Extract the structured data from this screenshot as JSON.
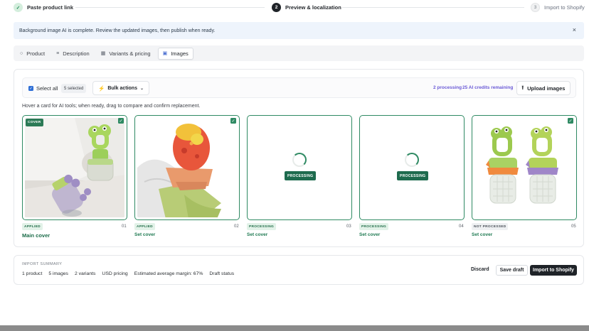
{
  "stepper": {
    "steps": [
      {
        "num": "✓",
        "label": "Paste product link"
      },
      {
        "num": "2",
        "label": "Preview & localization"
      },
      {
        "num": "3",
        "label": "Import to Shopify"
      }
    ]
  },
  "banner": {
    "text": "Background image AI is complete. Review the updated images, then publish when ready.",
    "close": "×"
  },
  "tabs": [
    {
      "icon": "○",
      "label": "Product"
    },
    {
      "icon": "≡",
      "label": "Description"
    },
    {
      "icon": "▦",
      "label": "Variants & pricing"
    },
    {
      "icon": "▣",
      "label": "Images"
    }
  ],
  "toolbar": {
    "select_all": "Select all",
    "selected": "5 selected",
    "bulk_actions": "Bulk actions",
    "processing": "2 processing",
    "credits": "25 AI credits remaining",
    "upload": "Upload images"
  },
  "hint": "Hover a card for AI tools; when ready, drag to compare and confirm replacement.",
  "cards": [
    {
      "cover_tag": "COVER",
      "status": "APPLIED",
      "index": "01",
      "action": "Main cover"
    },
    {
      "status": "APPLIED",
      "index": "02",
      "action": "Set cover"
    },
    {
      "overlay": "PROCESSING",
      "status": "PROCESSING",
      "index": "03",
      "action": "Set cover"
    },
    {
      "overlay": "PROCESSING",
      "status": "PROCESSING",
      "index": "04",
      "action": "Set cover"
    },
    {
      "status": "NOT PROCESSED",
      "index": "05",
      "action": "Set cover"
    }
  ],
  "summary": {
    "title": "IMPORT SUMMARY",
    "items": [
      "1 product",
      "5 images",
      "2 variants",
      "USD pricing",
      "Estimated average margin: 67%",
      "Draft status"
    ],
    "discard": "Discard",
    "save": "Save draft",
    "import": "Import to Shopify"
  },
  "colors": {
    "accent_green": "#2f8a63",
    "ai_purple": "#6a5ad6",
    "banner_bg": "#eef4fc",
    "primary_dark": "#1f2328"
  }
}
